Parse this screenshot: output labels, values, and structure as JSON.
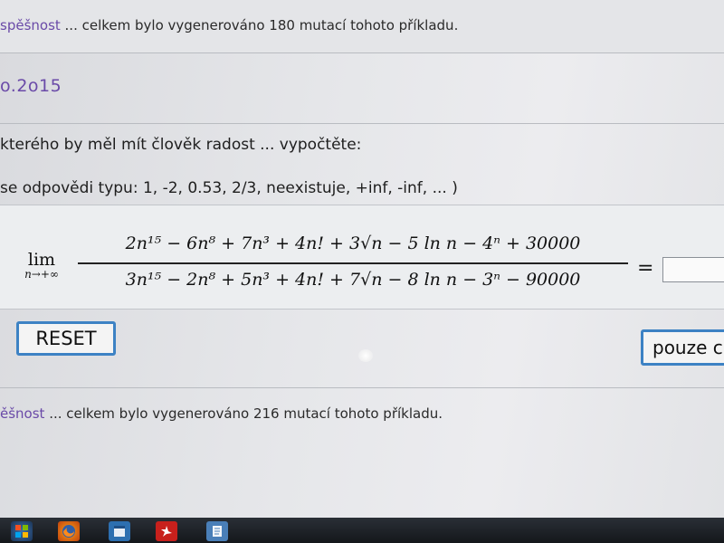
{
  "stats_top": {
    "word": "spěšnost",
    "text": " ... celkem bylo vygenerováno 180 mutací tohoto příkladu."
  },
  "problem": {
    "title": "o.2o15",
    "prompt": "kterého by měl mít člověk radost ... vypočtěte:",
    "hint": "se odpovědi typu: 1, -2, 0.53, 2/3, neexistuje, +inf, -inf, ... )"
  },
  "equation": {
    "lim_word": "lim",
    "lim_sub": "n→+∞",
    "numerator": "2n¹⁵ − 6n⁸ + 7n³ + 4n! + 3√n − 5 ln n − 4ⁿ + 30000",
    "denominator": "3n¹⁵ − 2n⁸ + 5n³ + 4n! + 7√n − 8 ln n − 3ⁿ − 90000",
    "equals": "=",
    "answer_value": ""
  },
  "buttons": {
    "reset": "RESET",
    "only": "pouze c"
  },
  "stats_bottom": {
    "word": "ěšnost",
    "text": " ... celkem bylo vygenerováno 216 mutací tohoto příkladu."
  },
  "taskbar": {
    "icons": [
      "windows-start-icon",
      "firefox-icon",
      "app-window-icon",
      "pdf-reader-icon",
      "document-window-icon"
    ]
  },
  "colors": {
    "accent_purple": "#6a4aa8",
    "button_border": "#3d82c4"
  }
}
